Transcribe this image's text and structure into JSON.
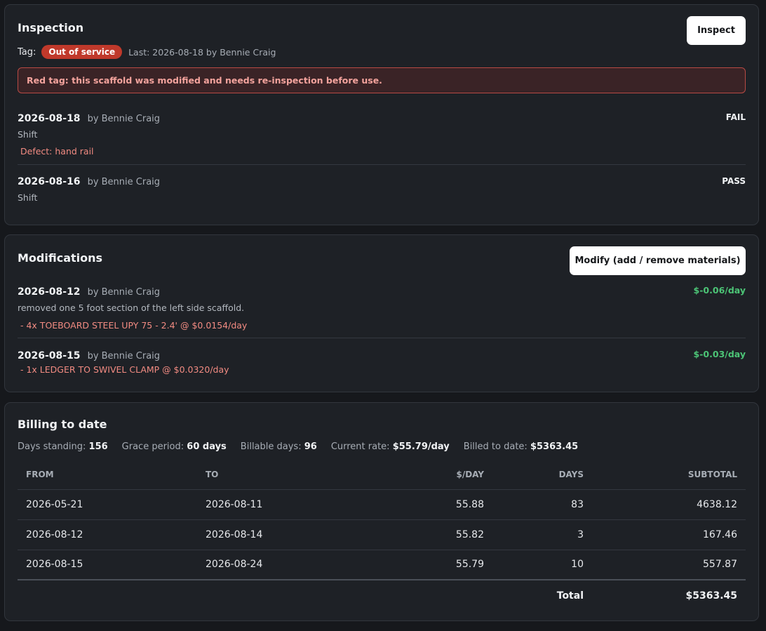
{
  "inspection": {
    "title": "Inspection",
    "button_label": "Inspect",
    "tag_label": "Tag:",
    "tag_value": "Out of service",
    "tag_color": "#c0392b",
    "last": "Last: 2026-08-18 by Bennie Craig",
    "alert": "Red tag: this scaffold was modified and needs re-inspection before use.",
    "records": [
      {
        "date": "2026-08-18",
        "by": "by Bennie Craig",
        "type": "Shift",
        "result": "FAIL",
        "defect": "Defect: hand rail"
      },
      {
        "date": "2026-08-16",
        "by": "by Bennie Craig",
        "type": "Shift",
        "result": "PASS"
      }
    ]
  },
  "modifications": {
    "title": "Modifications",
    "button_label": "Modify (add / remove materials)",
    "records": [
      {
        "date": "2026-08-12",
        "by": "by Bennie Craig",
        "rate": "$-0.06/day",
        "note": "removed one 5 foot section of the left side scaffold.",
        "item": "- 4x TOEBOARD STEEL UPY 75 - 2.4' @ $0.0154/day"
      },
      {
        "date": "2026-08-15",
        "by": "by Bennie Craig",
        "rate": "$-0.03/day",
        "item": "- 1x LEDGER TO SWIVEL CLAMP @ $0.0320/day"
      }
    ]
  },
  "billing": {
    "title": "Billing to date",
    "stats": [
      {
        "label": "Days standing:",
        "value": "156"
      },
      {
        "label": "Grace period:",
        "value": "60 days"
      },
      {
        "label": "Billable days:",
        "value": "96"
      },
      {
        "label": "Current rate:",
        "value": "$55.79/day"
      },
      {
        "label": "Billed to date:",
        "value": "$5363.45"
      }
    ],
    "columns": [
      "FROM",
      "TO",
      "$/DAY",
      "DAYS",
      "SUBTOTAL"
    ],
    "rows": [
      [
        "2026-05-21",
        "2026-08-11",
        "55.88",
        "83",
        "4638.12"
      ],
      [
        "2026-08-12",
        "2026-08-14",
        "55.82",
        "3",
        "167.46"
      ],
      [
        "2026-08-15",
        "2026-08-24",
        "55.79",
        "10",
        "557.87"
      ]
    ],
    "total_label": "Total",
    "total_value": "$5363.45"
  }
}
